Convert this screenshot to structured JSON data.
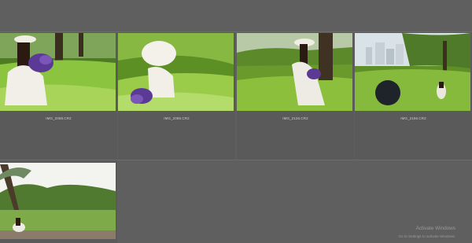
{
  "grid": {
    "photos": [
      {
        "filename": "IMG_2068.CR2"
      },
      {
        "filename": "IMG_2086.CR2"
      },
      {
        "filename": "IMG_2126.CR2"
      },
      {
        "filename": "IMG_2156.CR2"
      },
      {
        "filename": ""
      }
    ]
  },
  "watermark": {
    "title": "Activate Windows",
    "subtitle": "Go to Settings to activate Windows."
  },
  "colors": {
    "background": "#5f5f5f",
    "cell": "#5a5a5a",
    "grass": "#6f9a2e",
    "lavender": "#5b3a96",
    "dress": "#ece8e0"
  }
}
